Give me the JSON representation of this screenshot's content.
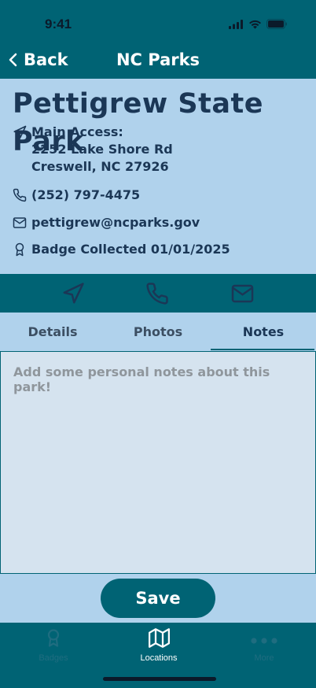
{
  "status": {
    "time": "9:41"
  },
  "nav": {
    "back_label": "Back",
    "title": "NC Parks"
  },
  "park": {
    "name": "Pettigrew State Park",
    "access_label": "Main Access:",
    "address_line1": "2252 Lake Shore Rd",
    "address_line2": "Creswell, NC 27926",
    "phone": "(252) 797-4475",
    "email": "pettigrew@ncparks.gov",
    "badge": "Badge Collected 01/01/2025"
  },
  "actions": [
    {
      "icon": "navigate-icon"
    },
    {
      "icon": "phone-icon"
    },
    {
      "icon": "mail-icon"
    }
  ],
  "tabs": [
    {
      "label": "Details",
      "active": false
    },
    {
      "label": "Photos",
      "active": false
    },
    {
      "label": "Notes",
      "active": true
    }
  ],
  "notes": {
    "placeholder": "Add some personal notes about this park!",
    "value": ""
  },
  "save_label": "Save",
  "tab_bar": [
    {
      "label": "Badges",
      "icon": "badge-icon",
      "active": false
    },
    {
      "label": "Locations",
      "icon": "map-icon",
      "active": true
    },
    {
      "label": "More",
      "icon": "more-icon",
      "active": false
    }
  ],
  "colors": {
    "primary": "#006374",
    "background": "#b0d2ec",
    "text": "#1b3756",
    "notes_bg": "#d5e3ef"
  }
}
